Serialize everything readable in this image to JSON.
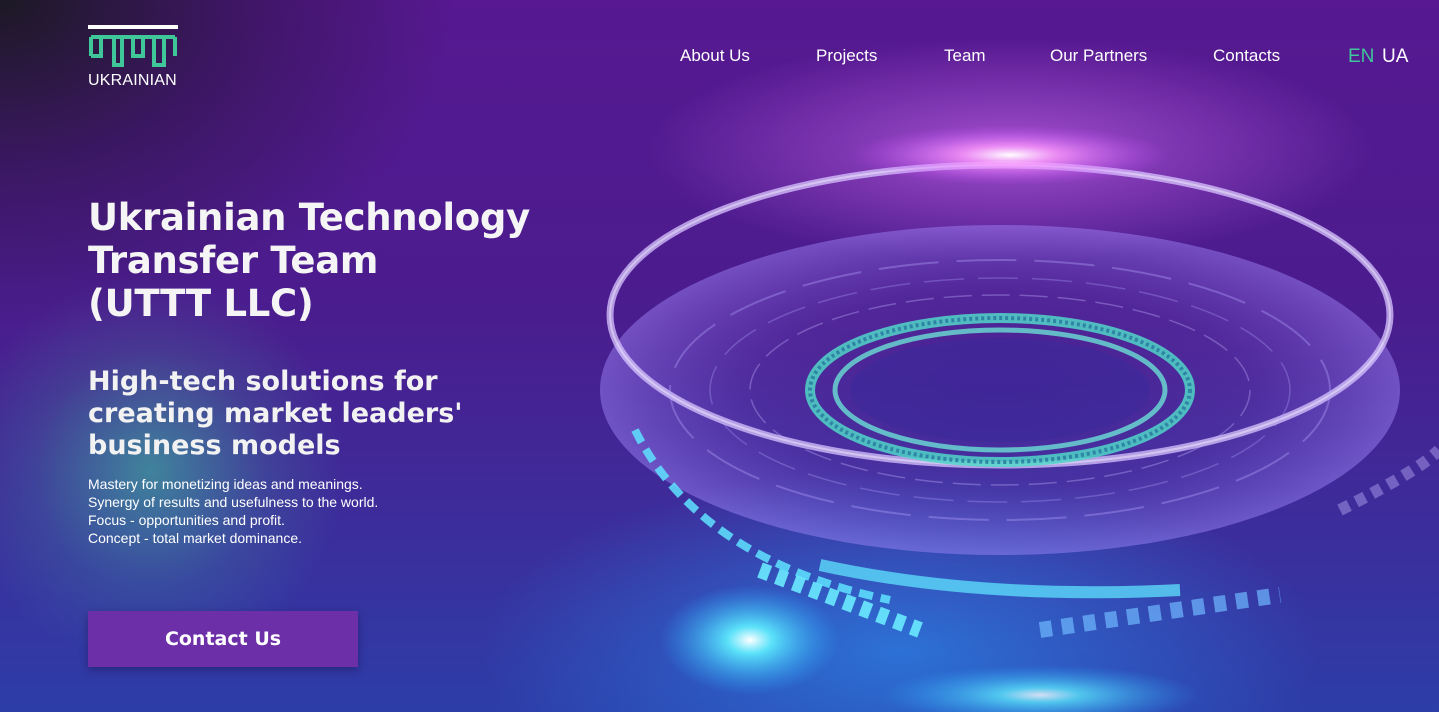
{
  "logo": {
    "text": "UKRAINIAN",
    "accent": "#3fc79a"
  },
  "nav": {
    "items": [
      {
        "label": "About Us"
      },
      {
        "label": "Projects"
      },
      {
        "label": "Team"
      },
      {
        "label": "Our Partners"
      },
      {
        "label": "Contacts"
      }
    ]
  },
  "language": {
    "options": [
      "EN",
      "UA"
    ],
    "selected": "EN"
  },
  "hero": {
    "title_lines": [
      "Ukrainian Technology",
      "Transfer Team",
      "(UTTT LLC)"
    ],
    "subtitle_lines": [
      "High-tech solutions for",
      "creating market leaders'",
      "business models"
    ],
    "description": [
      "Mastery for monetizing ideas and meanings.",
      "Synergy of results and usefulness to the world.",
      "Focus - opportunities and profit.",
      "Concept - total market dominance."
    ],
    "cta_label": "Contact Us"
  },
  "colors": {
    "background_purple": "#571891",
    "cta_purple": "#6d2fa8",
    "accent_green": "#3fc79a",
    "glow_cyan": "#3ee6f0"
  },
  "icons": {
    "hero_art": "tech-ring-illustration"
  }
}
